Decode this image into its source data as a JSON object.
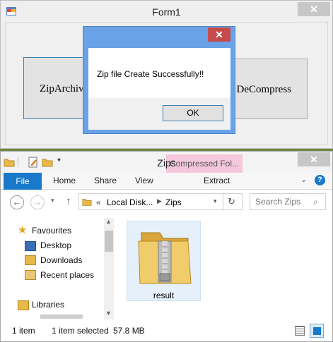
{
  "form1": {
    "title": "Form1",
    "close_glyph": "✕",
    "zip_button": "ZipArchive",
    "decompress_button": "DeCompress"
  },
  "msgbox": {
    "message": "Zip file Create Successfully!!",
    "ok_button": "OK",
    "close_glyph": "✕"
  },
  "explorer": {
    "title": "Zips",
    "close_glyph": "✕",
    "context_tab": "Compressed Fol...",
    "ribbon_tabs": [
      "File",
      "Home",
      "Share",
      "View",
      "Extract"
    ],
    "breadcrumb": [
      "«",
      "Local Disk...",
      "Zips"
    ],
    "search_placeholder": "Search Zips",
    "nav": {
      "favourites": "Favourites",
      "desktop": "Desktop",
      "downloads": "Downloads",
      "recent_places": "Recent places",
      "libraries": "Libraries"
    },
    "file_name": "result",
    "status": {
      "count": "1 item",
      "selected": "1 item selected",
      "size": "57.8 MB"
    }
  },
  "colors": {
    "accent": "#1979ca",
    "msgbox_frame": "#6aa2e8",
    "close_active": "#c74a4a",
    "context_tab": "#f4c7dc"
  }
}
